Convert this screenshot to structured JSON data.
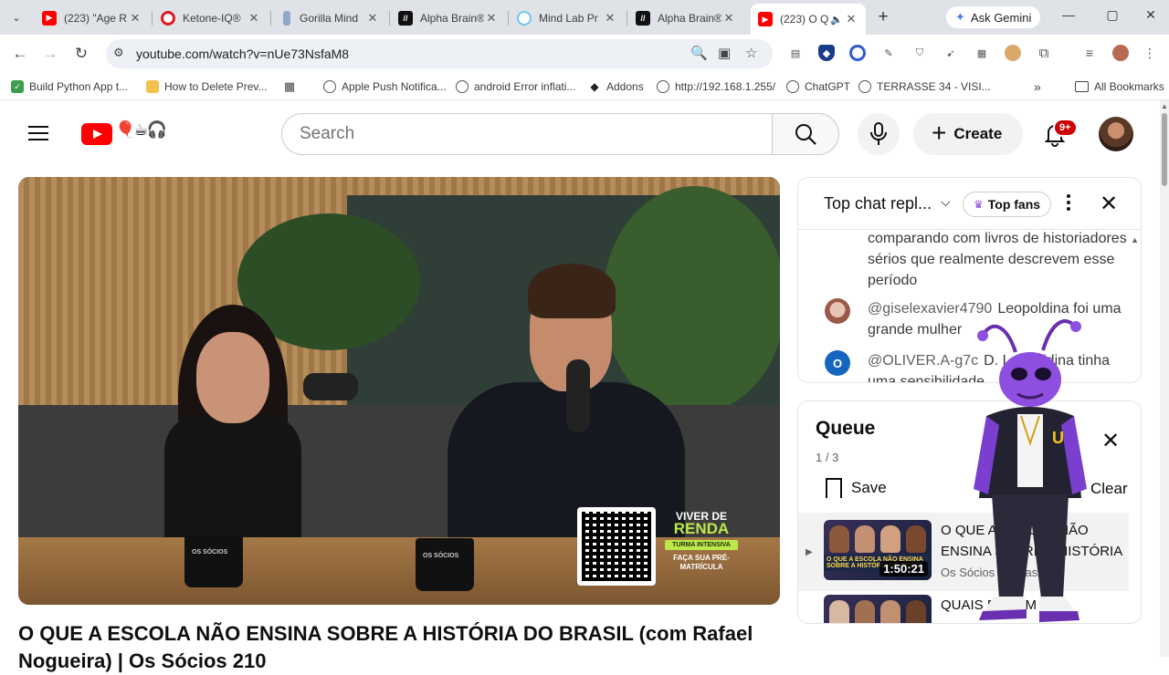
{
  "browser": {
    "tabs": [
      {
        "title": "(223) \"Age R",
        "icon": "youtube-icon",
        "color": "#ff0000"
      },
      {
        "title": "Ketone-IQ®",
        "icon": "opera-icon",
        "color": "#e01b24"
      },
      {
        "title": "Gorilla Mind",
        "icon": "bottle-icon",
        "color": "#6c8ebf"
      },
      {
        "title": "Alpha Brain®",
        "icon": "onnit-icon",
        "color": "#111111"
      },
      {
        "title": "Mind Lab Pr",
        "icon": "mindlab-icon",
        "color": "#6ec6e8"
      },
      {
        "title": "Alpha Brain®",
        "icon": "onnit-icon",
        "color": "#111111"
      },
      {
        "title": "(223) O Q",
        "icon": "youtube-icon",
        "color": "#ff0000"
      }
    ],
    "gemini_label": "Ask Gemini",
    "url": "youtube.com/watch?v=nUe73NsfaM8",
    "bookmarks": [
      {
        "label": "Build Python App t...",
        "color": "#3c9d4d"
      },
      {
        "label": "How to Delete Prev...",
        "color": "#f2c14e"
      },
      {
        "label": "",
        "color": "#444444"
      },
      {
        "label": "Apple Push Notifica...",
        "color": "#555555"
      },
      {
        "label": "android Error inflati...",
        "color": "#555555"
      },
      {
        "label": "Addons",
        "color": "#222222"
      },
      {
        "label": "http://192.168.1.255/",
        "color": "#555555"
      },
      {
        "label": "ChatGPT",
        "color": "#555555"
      },
      {
        "label": "TERRASSE 34 - VISI...",
        "color": "#555555"
      }
    ],
    "bookmarks_overflow": "»",
    "all_bookmarks_label": "All Bookmarks"
  },
  "youtube": {
    "search_placeholder": "Search",
    "create_label": "Create",
    "notification_count": "9+",
    "video": {
      "title": "O QUE A ESCOLA NÃO ENSINA SOBRE A HISTÓRIA DO BRASIL (com Rafael Nogueira) | Os Sócios 210",
      "promo_brand_1": "VIVER DE",
      "promo_brand_2": "RENDA",
      "promo_tag": "TURMA INTENSIVA",
      "promo_cta": "FAÇA SUA PRÉ-MATRÍCULA",
      "mug_text": "OS SÓCIOS"
    },
    "chat": {
      "title": "Top chat repl...",
      "top_fans_label": "Top fans",
      "messages": [
        {
          "author": "",
          "text": "comparando com livros de historiadores sérios que realmente descrevem esse período",
          "avatar_color": ""
        },
        {
          "author": "@giselexavier4790",
          "text": "Leopoldina foi uma grande mulher",
          "avatar_color": "#c89a86"
        },
        {
          "author": "@OLIVER.A-g7c",
          "text": "D. Leopoldina tinha uma sensibilidade",
          "avatar_color": "#1565c0",
          "avatar_letter": "O"
        }
      ]
    },
    "queue": {
      "title": "Queue",
      "position": "1 / 3",
      "save_label": "Save",
      "clear_label": "Clear",
      "items": [
        {
          "title": "O QUE A ESCOLA NÃO ENSINA SOBRE A HISTÓRIA DO BRASIL",
          "channel": "Os Sócios Podcast",
          "duration": "1:50:21",
          "thumb_caption": "O QUE A ESCOLA NÃO ENSINA SOBRE A HISTÓRIA DO BRASIL"
        },
        {
          "title": "QUAIS FORAM OS",
          "channel": "",
          "duration": "",
          "thumb_caption": ""
        }
      ]
    }
  }
}
